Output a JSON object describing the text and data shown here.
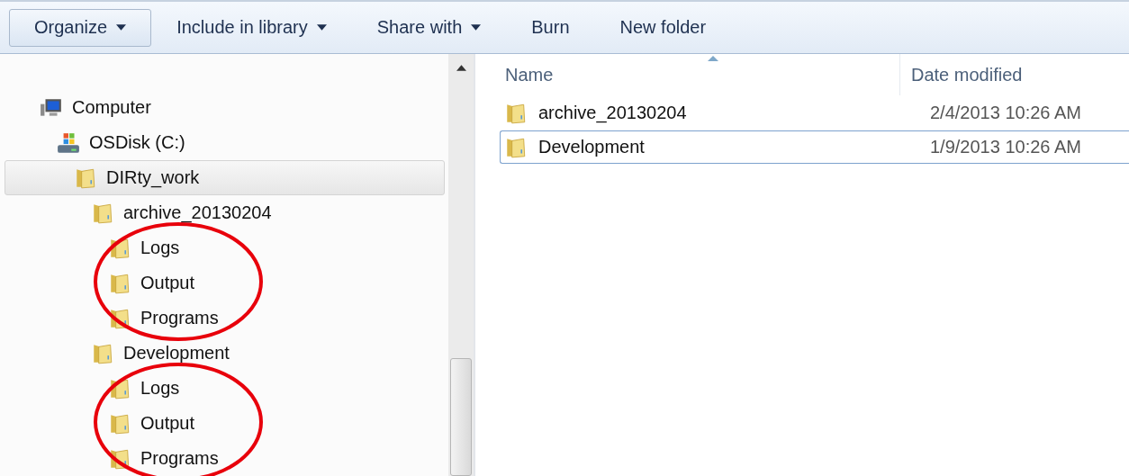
{
  "toolbar": [
    {
      "label": "Organize",
      "menu": true,
      "pressed": true
    },
    {
      "label": "Include in library",
      "menu": true,
      "pressed": false
    },
    {
      "label": "Share with",
      "menu": true,
      "pressed": false
    },
    {
      "label": "Burn",
      "menu": false,
      "pressed": false
    },
    {
      "label": "New folder",
      "menu": false,
      "pressed": false
    }
  ],
  "tree": [
    {
      "label": "Computer",
      "kind": "computer",
      "selected": false,
      "children": [
        {
          "label": "OSDisk (C:)",
          "kind": "disk",
          "selected": false,
          "children": [
            {
              "label": "DIRty_work",
              "kind": "folder",
              "selected": true,
              "children": [
                {
                  "label": "archive_20130204",
                  "kind": "folder",
                  "selected": false,
                  "circled": true,
                  "children": [
                    {
                      "label": "Logs",
                      "kind": "folder",
                      "selected": false
                    },
                    {
                      "label": "Output",
                      "kind": "folder",
                      "selected": false
                    },
                    {
                      "label": "Programs",
                      "kind": "folder",
                      "selected": false
                    }
                  ]
                },
                {
                  "label": "Development",
                  "kind": "folder",
                  "selected": false,
                  "circled": true,
                  "children": [
                    {
                      "label": "Logs",
                      "kind": "folder",
                      "selected": false
                    },
                    {
                      "label": "Output",
                      "kind": "folder",
                      "selected": false
                    },
                    {
                      "label": "Programs",
                      "kind": "folder",
                      "selected": false
                    }
                  ]
                }
              ]
            }
          ]
        }
      ]
    }
  ],
  "files": {
    "columns": [
      "Name",
      "Date modified"
    ],
    "rows": [
      {
        "name": "archive_20130204",
        "date": "2/4/2013 10:26 AM",
        "focused": false
      },
      {
        "name": "Development",
        "date": "1/9/2013 10:26 AM",
        "focused": true
      }
    ]
  }
}
